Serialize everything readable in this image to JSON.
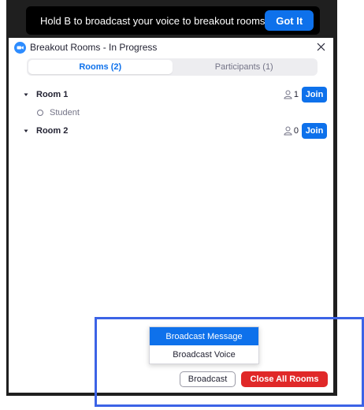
{
  "banner": {
    "text": "Hold B to broadcast your voice to breakout rooms",
    "got_it_label": "Got It"
  },
  "panel": {
    "title": "Breakout Rooms - In Progress",
    "tabs": [
      {
        "label": "Rooms (2)",
        "active": true
      },
      {
        "label": "Participants (1)",
        "active": false
      }
    ],
    "rooms": [
      {
        "name": "Room 1",
        "count": "1",
        "join_label": "Join",
        "participants": [
          "Student"
        ]
      },
      {
        "name": "Room 2",
        "count": "0",
        "join_label": "Join",
        "participants": []
      }
    ]
  },
  "broadcast_menu": {
    "items": [
      "Broadcast Message",
      "Broadcast Voice"
    ],
    "highlighted": "Broadcast Message"
  },
  "footer": {
    "broadcast_label": "Broadcast",
    "close_all_label": "Close All Rooms"
  },
  "icons": {
    "app_logo": "zoom-logo-icon",
    "close": "close-icon",
    "caret": "caret-down-icon",
    "person": "person-icon",
    "status": "status-circle-icon"
  },
  "colors": {
    "accent": "#0e71eb",
    "danger": "#e02828",
    "highlight_frame": "#3c63e6",
    "backdrop": "#1f1f1f"
  }
}
